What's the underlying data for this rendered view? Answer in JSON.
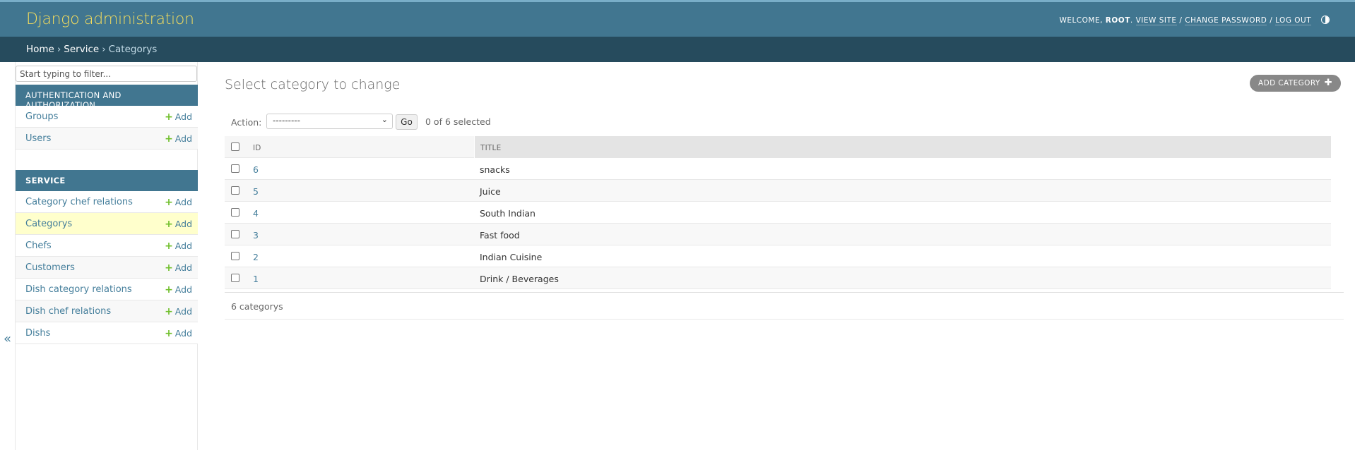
{
  "header": {
    "site_name": "Django administration",
    "welcome_prefix": "Welcome,",
    "username": "Root",
    "view_site": "View site",
    "change_password": "Change password",
    "log_out": "Log out",
    "separator": "/"
  },
  "breadcrumbs": {
    "home": "Home",
    "app": "Service",
    "current": "Categorys",
    "separator": "›"
  },
  "sidebar": {
    "filter_placeholder": "Start typing to filter...",
    "toggle_glyph": "«",
    "add_label": "Add",
    "auth_module": {
      "caption": "Authentication and Authorization",
      "items": [
        {
          "label": "Groups"
        },
        {
          "label": "Users"
        }
      ]
    },
    "service_module": {
      "caption": "Service",
      "items": [
        {
          "label": "Category chef relations"
        },
        {
          "label": "Categorys"
        },
        {
          "label": "Chefs"
        },
        {
          "label": "Customers"
        },
        {
          "label": "Dish category relations"
        },
        {
          "label": "Dish chef relations"
        },
        {
          "label": "Dishs"
        }
      ]
    }
  },
  "content": {
    "title": "Select category to change",
    "add_button": "Add category",
    "actions": {
      "label": "Action:",
      "selected_option": "---------",
      "go": "Go",
      "counter": "0 of 6 selected"
    },
    "table": {
      "columns": [
        "ID",
        "Title"
      ],
      "rows": [
        {
          "id": "6",
          "title": "snacks"
        },
        {
          "id": "5",
          "title": "Juice"
        },
        {
          "id": "4",
          "title": "South Indian"
        },
        {
          "id": "3",
          "title": "Fast food"
        },
        {
          "id": "2",
          "title": "Indian Cuisine"
        },
        {
          "id": "1",
          "title": "Drink / Beverages"
        }
      ]
    },
    "paginator": "6 categorys"
  },
  "colors": {
    "header_bg": "#417690",
    "breadcrumb_bg": "#264b5d",
    "brand_yellow": "#f5dd5d",
    "link": "#447e9b",
    "add_green": "#70bf2b",
    "selected_row": "#ffffcc"
  }
}
